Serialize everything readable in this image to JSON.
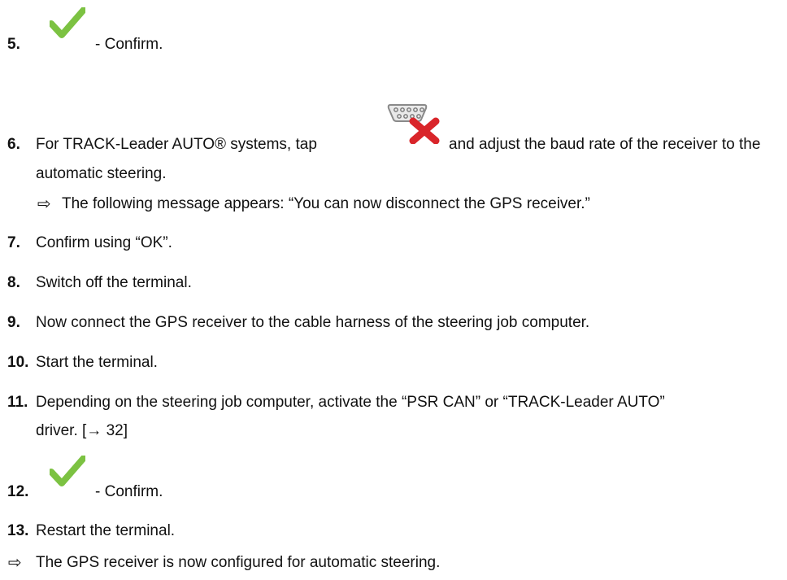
{
  "steps": [
    {
      "number": "5.",
      "text": "- Confirm.",
      "icon": "check-icon"
    },
    {
      "number": "6.",
      "text_before_icon": "For TRACK-Leader AUTO® systems, tap",
      "icon": "serial-port-disconnect-icon",
      "text_after_icon": "and adjust the baud rate of the receiver to the",
      "text_line2": "automatic steering.",
      "result_arrow": "⇨",
      "result": "The following message appears: “You can now disconnect the GPS receiver.”"
    },
    {
      "number": "7.",
      "text": "Confirm using “OK”."
    },
    {
      "number": "8.",
      "text": "Switch off the terminal."
    },
    {
      "number": "9.",
      "text": "Now connect the GPS receiver to the cable harness of the steering job computer."
    },
    {
      "number": "10.",
      "text": "Start the terminal."
    },
    {
      "number": "11.",
      "text": "Depending on the steering job computer, activate the “PSR CAN” or “TRACK-Leader AUTO”",
      "text_line2": "driver. [→ 32]"
    },
    {
      "number": "12.",
      "text": "- Confirm.",
      "icon": "check-icon"
    },
    {
      "number": "13.",
      "text": "Restart the terminal."
    }
  ],
  "final_result": {
    "arrow": "⇨",
    "text": "The GPS receiver is now configured for automatic steering."
  },
  "colors": {
    "check": "#7cc242",
    "cross": "#d9252a",
    "text": "#111111"
  }
}
